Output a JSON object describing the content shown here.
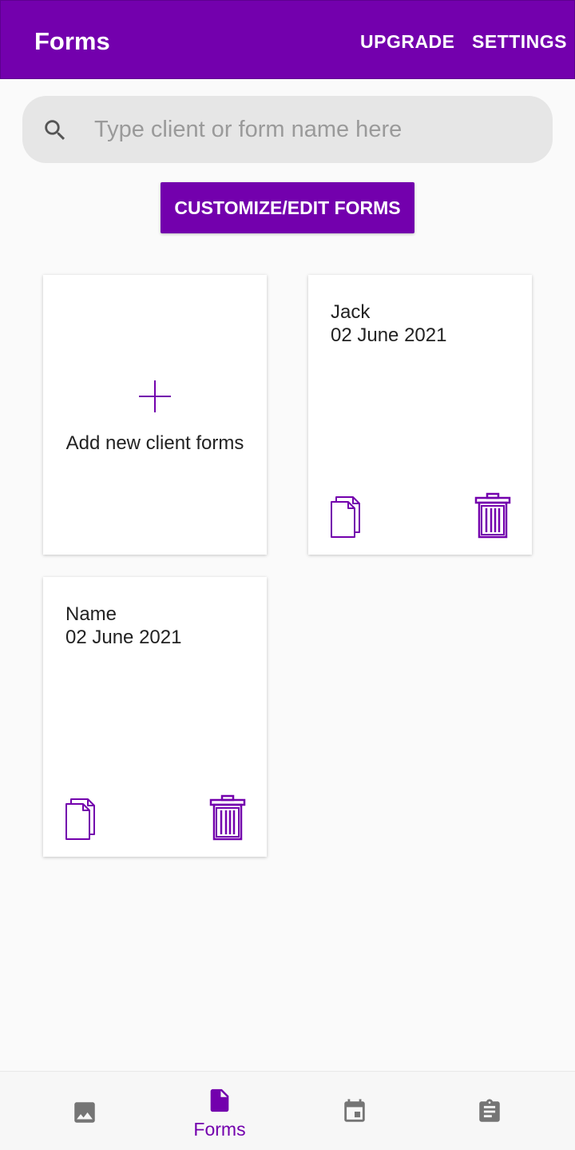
{
  "appbar": {
    "title": "Forms",
    "upgrade_label": "UPGRADE",
    "settings_label": "SETTINGS"
  },
  "search": {
    "placeholder": "Type client or form name here",
    "value": "",
    "icon": "search-icon"
  },
  "customize_button": {
    "label": "CUSTOMIZE/EDIT FORMS"
  },
  "add_card": {
    "label": "Add new client forms",
    "icon": "plus-icon"
  },
  "forms": [
    {
      "name": "Jack",
      "date": "02 June 2021"
    },
    {
      "name": "Name",
      "date": "02 June 2021"
    }
  ],
  "bottom_nav": {
    "items": [
      {
        "icon": "image-icon",
        "label": "",
        "active": false
      },
      {
        "icon": "document-icon",
        "label": "Forms",
        "active": true
      },
      {
        "icon": "calendar-icon",
        "label": "",
        "active": false
      },
      {
        "icon": "clipboard-icon",
        "label": "",
        "active": false
      }
    ]
  },
  "colors": {
    "primary": "#7300ad",
    "background": "#fafafa",
    "search_bg": "#e6e6e6",
    "inactive_icon": "#757575"
  }
}
